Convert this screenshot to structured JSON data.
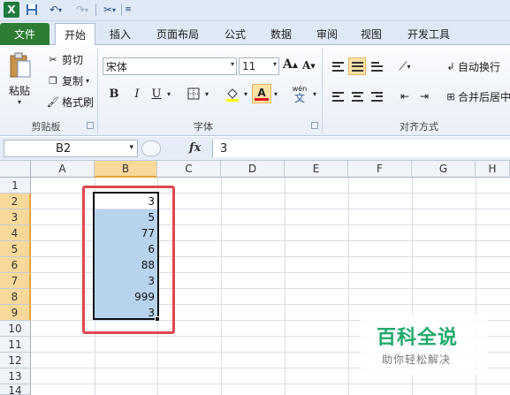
{
  "app": {
    "logo": "X"
  },
  "qat": {
    "save_icon": "save-icon",
    "undo_icon": "undo-icon",
    "redo_icon": "redo-icon",
    "customize_icon": "customize-icon"
  },
  "tabs": [
    {
      "label": "文件"
    },
    {
      "label": "开始"
    },
    {
      "label": "插入"
    },
    {
      "label": "页面布局"
    },
    {
      "label": "公式"
    },
    {
      "label": "数据"
    },
    {
      "label": "审阅"
    },
    {
      "label": "视图"
    },
    {
      "label": "开发工具"
    }
  ],
  "ribbon": {
    "clipboard": {
      "paste": "粘贴",
      "cut": "剪切",
      "copy": "复制",
      "format_painter": "格式刷",
      "group_label": "剪贴板"
    },
    "font": {
      "font_name": "宋体",
      "font_size": "11",
      "bold": "B",
      "italic": "I",
      "underline": "U",
      "font_color_letter": "A",
      "phonetic": "wén",
      "phonetic_char": "文",
      "grow": "A",
      "shrink": "A",
      "group_label": "字体"
    },
    "alignment": {
      "wrap_text": "自动换行",
      "merge_center": "合并后居中",
      "group_label": "对齐方式"
    }
  },
  "formula_bar": {
    "name_box": "B2",
    "fx_label": "fx",
    "value": "3"
  },
  "grid": {
    "columns": [
      "A",
      "B",
      "C",
      "D",
      "E",
      "F",
      "G",
      "H"
    ],
    "rows": [
      "1",
      "2",
      "3",
      "4",
      "5",
      "6",
      "7",
      "8",
      "9",
      "10",
      "11",
      "12",
      "13",
      "14"
    ],
    "selected_column": "B",
    "column_b_values": [
      "3",
      "5",
      "77",
      "6",
      "88",
      "3",
      "999",
      "3"
    ]
  },
  "watermark": {
    "title": "百科全说",
    "subtitle": "助你轻松解决"
  },
  "colors": {
    "file_tab": "#2e7d32",
    "selection_fill": "#b8d3ee",
    "highlight_box": "#e0484e",
    "watermark_green": "#1fa96b"
  }
}
